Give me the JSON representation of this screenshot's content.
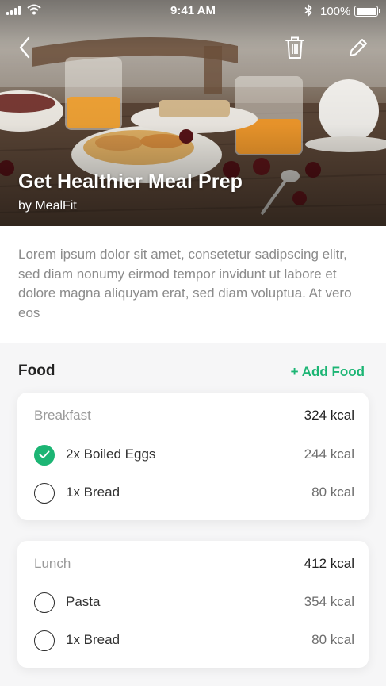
{
  "status_bar": {
    "time": "9:41 AM",
    "battery": "100%"
  },
  "hero": {
    "title": "Get Healthier Meal Prep",
    "author": "by MealFit"
  },
  "description": "Lorem ipsum dolor sit amet, consetetur sadipscing elitr, sed diam nonumy eirmod tempor invidunt ut labore et dolore magna aliquyam erat, sed diam voluptua. At vero eos",
  "food": {
    "title": "Food",
    "add_label": "+ Add Food",
    "meals": [
      {
        "name": "Breakfast",
        "kcal": "324 kcal",
        "items": [
          {
            "name": "2x Boiled Eggs",
            "kcal": "244 kcal",
            "checked": true
          },
          {
            "name": "1x Bread",
            "kcal": "80 kcal",
            "checked": false
          }
        ]
      },
      {
        "name": "Lunch",
        "kcal": "412 kcal",
        "items": [
          {
            "name": "Pasta",
            "kcal": "354 kcal",
            "checked": false
          },
          {
            "name": "1x Bread",
            "kcal": "80 kcal",
            "checked": false
          }
        ]
      }
    ]
  },
  "colors": {
    "accent": "#1cb574",
    "background": "#f6f6f7"
  },
  "icons": {
    "back": "chevron-left-icon",
    "delete": "trash-icon",
    "edit": "pencil-icon",
    "check": "checkmark-icon"
  }
}
